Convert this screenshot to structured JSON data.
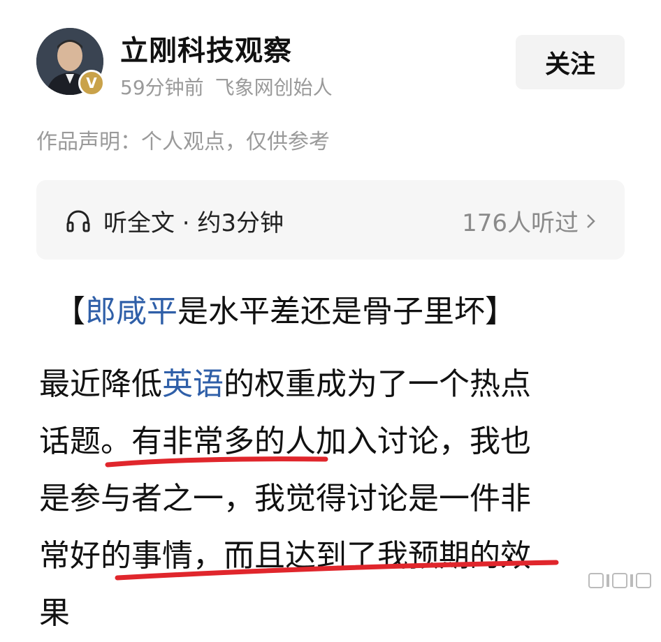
{
  "author": {
    "name": "立刚科技观察",
    "time": "59分钟前",
    "role": "飞象网创始人",
    "verify_badge": "V"
  },
  "follow_label": "关注",
  "statement": "作品声明：个人观点，仅供参考",
  "listen": {
    "left_text": "听全文 · 约3分钟",
    "right_text": "176人听过"
  },
  "article": {
    "title_open": "【",
    "title_link": "郎咸平",
    "title_rest": "是水平差还是骨子里坏】",
    "lines": {
      "l1_a": "最近降低",
      "l1_link": "英语",
      "l1_b": "的权重成为了一个热点",
      "l2": "话题。有非常多的人加入讨论，我也",
      "l3": "是参与者之一，我觉得讨论是一件非",
      "l4": "常好的事情，而且达到了我预期的效",
      "l5": "果"
    }
  },
  "colors": {
    "link": "#2f5fa8",
    "underline": "#e0262c",
    "badge": "#c9a24a"
  },
  "icons": [
    "headphones-icon",
    "chevron-right-icon",
    "verified-badge-icon"
  ]
}
